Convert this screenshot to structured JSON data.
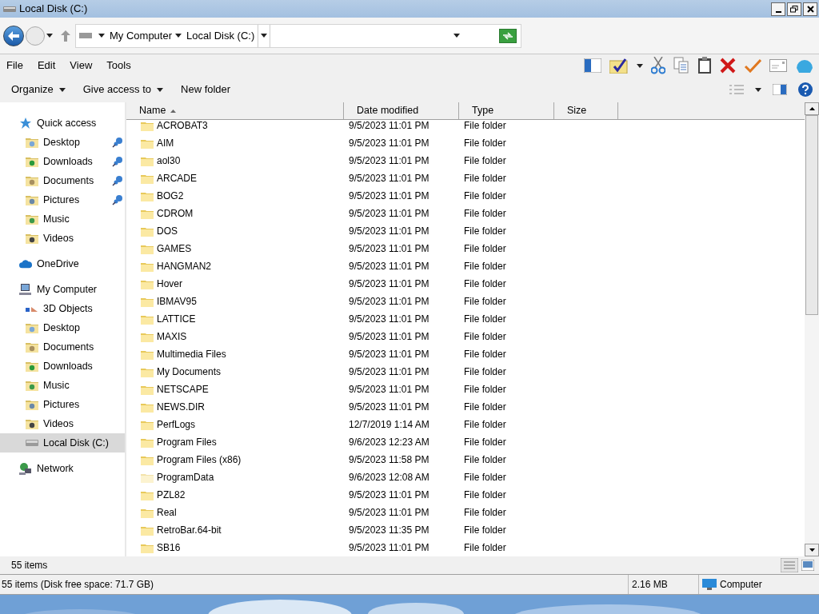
{
  "window": {
    "title": "Local Disk (C:)"
  },
  "address": {
    "crumbs": [
      "My Computer",
      "Local Disk (C:)"
    ]
  },
  "menu": [
    "File",
    "Edit",
    "View",
    "Tools"
  ],
  "commands": [
    {
      "label": "Organize",
      "dropdown": true
    },
    {
      "label": "Give access to",
      "dropdown": true
    },
    {
      "label": "New folder",
      "dropdown": false
    }
  ],
  "sidebar": {
    "sections": [
      {
        "label": "Quick access",
        "kind": "star",
        "selected": false,
        "children": [
          {
            "label": "Desktop",
            "kind": "desktop",
            "pinned": true,
            "selected": false
          },
          {
            "label": "Downloads",
            "kind": "downloads",
            "pinned": true,
            "selected": false
          },
          {
            "label": "Documents",
            "kind": "documents",
            "pinned": true,
            "selected": false
          },
          {
            "label": "Pictures",
            "kind": "pictures",
            "pinned": true,
            "selected": false
          },
          {
            "label": "Music",
            "kind": "music",
            "pinned": false,
            "selected": false
          },
          {
            "label": "Videos",
            "kind": "videos",
            "pinned": false,
            "selected": false
          }
        ]
      },
      {
        "label": "OneDrive",
        "kind": "cloud",
        "selected": false
      },
      {
        "label": "My Computer",
        "kind": "computer",
        "selected": false,
        "children": [
          {
            "label": "3D Objects",
            "kind": "objects",
            "pinned": false,
            "selected": false
          },
          {
            "label": "Desktop",
            "kind": "desktop",
            "pinned": false,
            "selected": false
          },
          {
            "label": "Documents",
            "kind": "documents",
            "pinned": false,
            "selected": false
          },
          {
            "label": "Downloads",
            "kind": "downloads",
            "pinned": false,
            "selected": false
          },
          {
            "label": "Music",
            "kind": "music",
            "pinned": false,
            "selected": false
          },
          {
            "label": "Pictures",
            "kind": "pictures",
            "pinned": false,
            "selected": false
          },
          {
            "label": "Videos",
            "kind": "videos",
            "pinned": false,
            "selected": false
          },
          {
            "label": "Local Disk (C:)",
            "kind": "drive",
            "pinned": false,
            "selected": true
          }
        ]
      },
      {
        "label": "Network",
        "kind": "network",
        "selected": false
      }
    ]
  },
  "table": {
    "columns": [
      "Name",
      "Date modified",
      "Type",
      "Size"
    ],
    "rows": [
      {
        "name": "ACROBAT3",
        "date": "9/5/2023 11:01 PM",
        "type": "File folder",
        "hidden": false
      },
      {
        "name": "AIM",
        "date": "9/5/2023 11:01 PM",
        "type": "File folder",
        "hidden": false
      },
      {
        "name": "aol30",
        "date": "9/5/2023 11:01 PM",
        "type": "File folder",
        "hidden": false
      },
      {
        "name": "ARCADE",
        "date": "9/5/2023 11:01 PM",
        "type": "File folder",
        "hidden": false
      },
      {
        "name": "BOG2",
        "date": "9/5/2023 11:01 PM",
        "type": "File folder",
        "hidden": false
      },
      {
        "name": "CDROM",
        "date": "9/5/2023 11:01 PM",
        "type": "File folder",
        "hidden": false
      },
      {
        "name": "DOS",
        "date": "9/5/2023 11:01 PM",
        "type": "File folder",
        "hidden": false
      },
      {
        "name": "GAMES",
        "date": "9/5/2023 11:01 PM",
        "type": "File folder",
        "hidden": false
      },
      {
        "name": "HANGMAN2",
        "date": "9/5/2023 11:01 PM",
        "type": "File folder",
        "hidden": false
      },
      {
        "name": "Hover",
        "date": "9/5/2023 11:01 PM",
        "type": "File folder",
        "hidden": false
      },
      {
        "name": "IBMAV95",
        "date": "9/5/2023 11:01 PM",
        "type": "File folder",
        "hidden": false
      },
      {
        "name": "LATTICE",
        "date": "9/5/2023 11:01 PM",
        "type": "File folder",
        "hidden": false
      },
      {
        "name": "MAXIS",
        "date": "9/5/2023 11:01 PM",
        "type": "File folder",
        "hidden": false
      },
      {
        "name": "Multimedia Files",
        "date": "9/5/2023 11:01 PM",
        "type": "File folder",
        "hidden": false
      },
      {
        "name": "My Documents",
        "date": "9/5/2023 11:01 PM",
        "type": "File folder",
        "hidden": false
      },
      {
        "name": "NETSCAPE",
        "date": "9/5/2023 11:01 PM",
        "type": "File folder",
        "hidden": false
      },
      {
        "name": "NEWS.DIR",
        "date": "9/5/2023 11:01 PM",
        "type": "File folder",
        "hidden": false
      },
      {
        "name": "PerfLogs",
        "date": "12/7/2019 1:14 AM",
        "type": "File folder",
        "hidden": false
      },
      {
        "name": "Program Files",
        "date": "9/6/2023 12:23 AM",
        "type": "File folder",
        "hidden": false
      },
      {
        "name": "Program Files (x86)",
        "date": "9/5/2023 11:58 PM",
        "type": "File folder",
        "hidden": false
      },
      {
        "name": "ProgramData",
        "date": "9/6/2023 12:08 AM",
        "type": "File folder",
        "hidden": true
      },
      {
        "name": "PZL82",
        "date": "9/5/2023 11:01 PM",
        "type": "File folder",
        "hidden": false
      },
      {
        "name": "Real",
        "date": "9/5/2023 11:01 PM",
        "type": "File folder",
        "hidden": false
      },
      {
        "name": "RetroBar.64-bit",
        "date": "9/5/2023 11:35 PM",
        "type": "File folder",
        "hidden": false
      },
      {
        "name": "SB16",
        "date": "9/5/2023 11:01 PM",
        "type": "File folder",
        "hidden": false
      }
    ]
  },
  "details_bar": {
    "count": "55 items"
  },
  "status_bar": {
    "summary": "55 items (Disk free space: 71.7 GB)",
    "size": "2.16 MB",
    "zone": "Computer"
  }
}
